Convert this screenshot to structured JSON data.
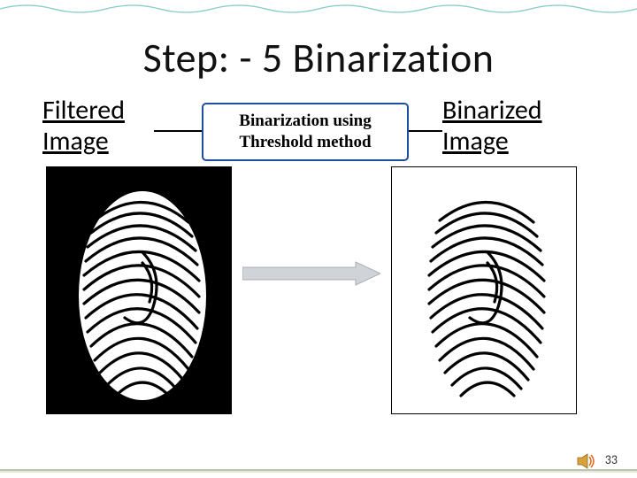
{
  "title": "Step: - 5 Binarization",
  "labels": {
    "left": "Filtered\nImage",
    "right": "Binarized\nImage"
  },
  "method_box": {
    "line1": "Binarization using",
    "line2": "Threshold method"
  },
  "page_number": "33",
  "colors": {
    "border_blue": "#1f4e9b",
    "arrow_fill": "#d0d3d8",
    "accent_teal": "#2aa7a7"
  }
}
